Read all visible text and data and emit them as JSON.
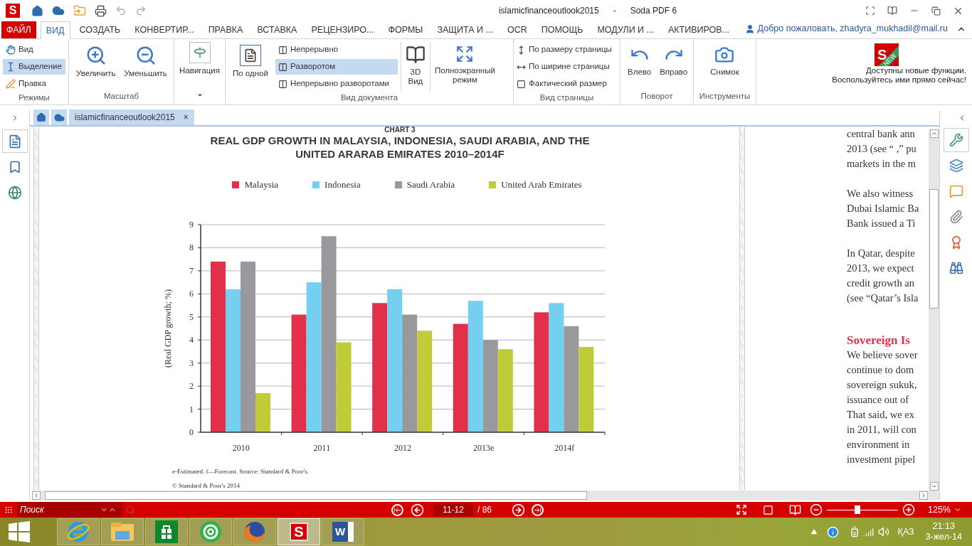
{
  "title_bar": {
    "logo_letter": "S",
    "document_name": "islamicfinanceoutlook2015",
    "separator": "-",
    "app_name": "Soda PDF 6"
  },
  "menu_tabs": [
    {
      "label": "ФАЙЛ",
      "kind": "file",
      "selected": false
    },
    {
      "label": "ВИД",
      "kind": "tab",
      "selected": true
    },
    {
      "label": "СОЗДАТЬ",
      "kind": "tab",
      "selected": false
    },
    {
      "label": "КОНВЕРТИР...",
      "kind": "tab",
      "selected": false
    },
    {
      "label": "ПРАВКА",
      "kind": "tab",
      "selected": false
    },
    {
      "label": "ВСТАВКА",
      "kind": "tab",
      "selected": false
    },
    {
      "label": "РЕЦЕНЗИРО...",
      "kind": "tab",
      "selected": false
    },
    {
      "label": "ФОРМЫ",
      "kind": "tab",
      "selected": false
    },
    {
      "label": "ЗАЩИТА И ...",
      "kind": "tab",
      "selected": false
    },
    {
      "label": "OCR",
      "kind": "tab",
      "selected": false
    },
    {
      "label": "ПОМОЩЬ",
      "kind": "tab",
      "selected": false
    },
    {
      "label": "МОДУЛИ И ...",
      "kind": "tab",
      "selected": false
    },
    {
      "label": "АКТИВИРОВ...",
      "kind": "tab",
      "selected": false
    }
  ],
  "account": "Добро пожаловать, zhadyra_mukhadil@mail.ru",
  "ribbon": {
    "modes": {
      "label": "Режимы",
      "items": [
        {
          "label": "Вид",
          "selected": false
        },
        {
          "label": "Выделение",
          "selected": true
        },
        {
          "label": "Правка",
          "selected": false
        }
      ]
    },
    "zoom": {
      "label": "Масштаб",
      "zoom_in": "Увеличить",
      "zoom_out": "Уменьшить"
    },
    "navigation": {
      "label": "Навигация"
    },
    "document_view": {
      "label": "Вид документа",
      "single": "По одной",
      "layouts": [
        {
          "label": "Непрерывно",
          "selected": false
        },
        {
          "label": "Разворотом",
          "selected": true
        },
        {
          "label": "Непрерывно разворотами",
          "selected": false
        }
      ],
      "three_d": [
        "3D",
        "Вид"
      ],
      "fullscreen": [
        "Полноэкранный",
        "режим"
      ]
    },
    "page_view": {
      "label": "Вид страницы",
      "items": [
        "По размеру страницы",
        "По ширине страницы",
        "Фактический размер"
      ]
    },
    "rotate": {
      "label": "Поворот",
      "left": "Влево",
      "right": "Вправо"
    },
    "tools": {
      "label": "Инструменты",
      "snapshot": "Снимок"
    },
    "promo": {
      "logo_letter": "S",
      "badge": "NEW",
      "lines": [
        "Доступны новые функции.",
        "Воспользуйтесь ими прямо сейчас!"
      ]
    }
  },
  "document_tabs": [
    {
      "label": "islamicfinanceoutlook2015",
      "close": "×",
      "selected": true
    }
  ],
  "chart": {
    "label": "CHART 3",
    "title_lines": [
      "REAL GDP GROWTH IN MALAYSIA, INDONESIA, SAUDI ARABIA, AND THE",
      "UNITED ARARAB EMIRATES 2010–2014F"
    ],
    "chart_data": {
      "type": "bar",
      "grid": true,
      "ylabel": "(Real GDP growth; %)",
      "categories": [
        "2010",
        "2011",
        "2012",
        "2013e",
        "2014f"
      ],
      "ylim": [
        0,
        9
      ],
      "yticks": [
        0,
        1,
        2,
        3,
        4,
        5,
        6,
        7,
        8,
        9
      ],
      "series": [
        {
          "name": "Malaysia",
          "color": "#e2304a",
          "values": [
            7.4,
            5.1,
            5.6,
            4.7,
            5.2
          ]
        },
        {
          "name": "Indonesia",
          "color": "#74cff0",
          "values": [
            6.2,
            6.5,
            6.2,
            5.7,
            5.6
          ]
        },
        {
          "name": "Saudi Arabia",
          "color": "#99999d",
          "values": [
            7.4,
            8.5,
            5.1,
            4.0,
            4.6
          ]
        },
        {
          "name": "United Arab Emirates",
          "color": "#c0cb38",
          "values": [
            1.7,
            3.9,
            4.4,
            3.6,
            3.7
          ]
        }
      ]
    },
    "footnotes": [
      "e-Estimated. f—Forecast. Source: Standard & Poor's.",
      "© Standard & Poor's 2014"
    ]
  },
  "right_page": [
    {
      "kind": "body",
      "lines": [
        "central bank ann",
        "2013 (see “ ,” pu",
        "markets in the m"
      ]
    },
    {
      "kind": "body",
      "lines": [
        "We also witness",
        "Dubai Islamic Ba",
        "Bank issued a Ti"
      ]
    },
    {
      "kind": "body",
      "lines": [
        "In Qatar, despite",
        "2013, we expect",
        "credit growth an",
        "(see “Qatar’s Isla"
      ]
    },
    {
      "kind": "heading",
      "lines": [
        "Sovereign Is"
      ]
    },
    {
      "kind": "body",
      "lines": [
        "We believe sover",
        "continue to dom",
        "sovereign sukuk,",
        "issuance out of",
        "That said, we ex",
        "in 2011, will con",
        "environment in",
        "investment pipel"
      ]
    }
  ],
  "left_panel": [
    {
      "kind": "thumbnails",
      "selected": true
    },
    {
      "kind": "bookmarks",
      "selected": false
    },
    {
      "kind": "links",
      "selected": false
    }
  ],
  "right_panel": [
    {
      "kind": "tools",
      "selected": true
    },
    {
      "kind": "layers",
      "selected": false
    },
    {
      "kind": "comments",
      "selected": false
    },
    {
      "kind": "attachments",
      "selected": false
    },
    {
      "kind": "signature",
      "selected": false
    },
    {
      "kind": "search",
      "selected": false
    }
  ],
  "status_bar": {
    "search_placeholder": "Поиск",
    "page": "11-12",
    "total": "/ 86",
    "zoom": "125%",
    "level": 0.43
  },
  "taskbar": {
    "apps": [
      {
        "kind": "ie",
        "selected": false
      },
      {
        "kind": "explorer",
        "selected": false
      },
      {
        "kind": "store",
        "selected": false
      },
      {
        "kind": "mail",
        "selected": false
      },
      {
        "kind": "firefox",
        "selected": false
      },
      {
        "kind": "soda",
        "selected": true
      },
      {
        "kind": "word",
        "selected": false
      }
    ],
    "soda_letter": "S",
    "word_letter": "W",
    "language": "ҚАЗ",
    "time": "21:13",
    "date": "3-жел-14"
  }
}
